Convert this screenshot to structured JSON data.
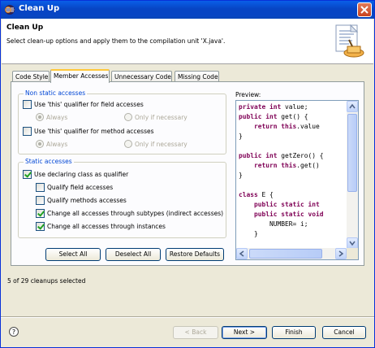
{
  "window": {
    "title": "Clean Up"
  },
  "header": {
    "title": "Clean Up",
    "description": "Select clean-up options and apply them to the compilation unit 'X.java'."
  },
  "tabs": [
    {
      "label": "Code Style",
      "active": false
    },
    {
      "label": "Member Accesses",
      "active": true
    },
    {
      "label": "Unnecessary Code",
      "active": false
    },
    {
      "label": "Missing Code",
      "active": false
    }
  ],
  "non_static": {
    "title": "Non static accesses",
    "field_qualifier": {
      "label": "Use 'this' qualifier for field accesses",
      "checked": false
    },
    "field_always": "Always",
    "field_if_necessary": "Only if necessary",
    "method_qualifier": {
      "label": "Use 'this' qualifier for method accesses",
      "checked": false
    },
    "method_always": "Always",
    "method_if_necessary": "Only if necessary"
  },
  "static": {
    "title": "Static accesses",
    "declaring_class": {
      "label": "Use declaring class as qualifier",
      "checked": true
    },
    "qualify_field": {
      "label": "Qualify field accesses",
      "checked": false
    },
    "qualify_method": {
      "label": "Qualify methods accesses",
      "checked": false
    },
    "through_subtypes": {
      "label": "Change all accesses through subtypes (indirect accesses)",
      "checked": true
    },
    "through_instances": {
      "label": "Change all accesses through instances",
      "checked": true
    }
  },
  "buttons": {
    "select_all": "Select All",
    "deselect_all": "Deselect All",
    "restore_defaults": "Restore Defaults",
    "back": "< Back",
    "next": "Next >",
    "finish": "Finish",
    "cancel": "Cancel"
  },
  "preview": {
    "label": "Preview:",
    "lines": [
      [
        [
          "kw",
          "private int"
        ],
        [
          "t",
          " value;"
        ]
      ],
      [
        [
          "kw",
          "public int"
        ],
        [
          "t",
          " get() {"
        ]
      ],
      [
        [
          "t",
          "    "
        ],
        [
          "kw",
          "return this"
        ],
        [
          "t",
          ".value"
        ]
      ],
      [
        [
          "t",
          "}"
        ]
      ],
      [
        [
          "t",
          ""
        ]
      ],
      [
        [
          "kw",
          "public int"
        ],
        [
          "t",
          " getZero() {"
        ]
      ],
      [
        [
          "t",
          "    "
        ],
        [
          "kw",
          "return this"
        ],
        [
          "t",
          ".get()"
        ]
      ],
      [
        [
          "t",
          "}"
        ]
      ],
      [
        [
          "t",
          ""
        ]
      ],
      [
        [
          "kw",
          "class"
        ],
        [
          "t",
          " E {"
        ]
      ],
      [
        [
          "t",
          "    "
        ],
        [
          "kw",
          "public static int"
        ]
      ],
      [
        [
          "t",
          "    "
        ],
        [
          "kw",
          "public static void"
        ]
      ],
      [
        [
          "t",
          "        NUMBER= i;"
        ]
      ],
      [
        [
          "t",
          "    }"
        ]
      ]
    ]
  },
  "status": "5 of 29 cleanups selected",
  "icons": {
    "app": "eclipse-icon",
    "close": "close-icon",
    "wizard": "clean-up-wizard-icon",
    "help": "help-icon"
  },
  "colors": {
    "titlebar": "#0745c4",
    "group_title": "#0046d5",
    "keyword": "#7f0055",
    "tab_highlight": "#ffc83c"
  }
}
